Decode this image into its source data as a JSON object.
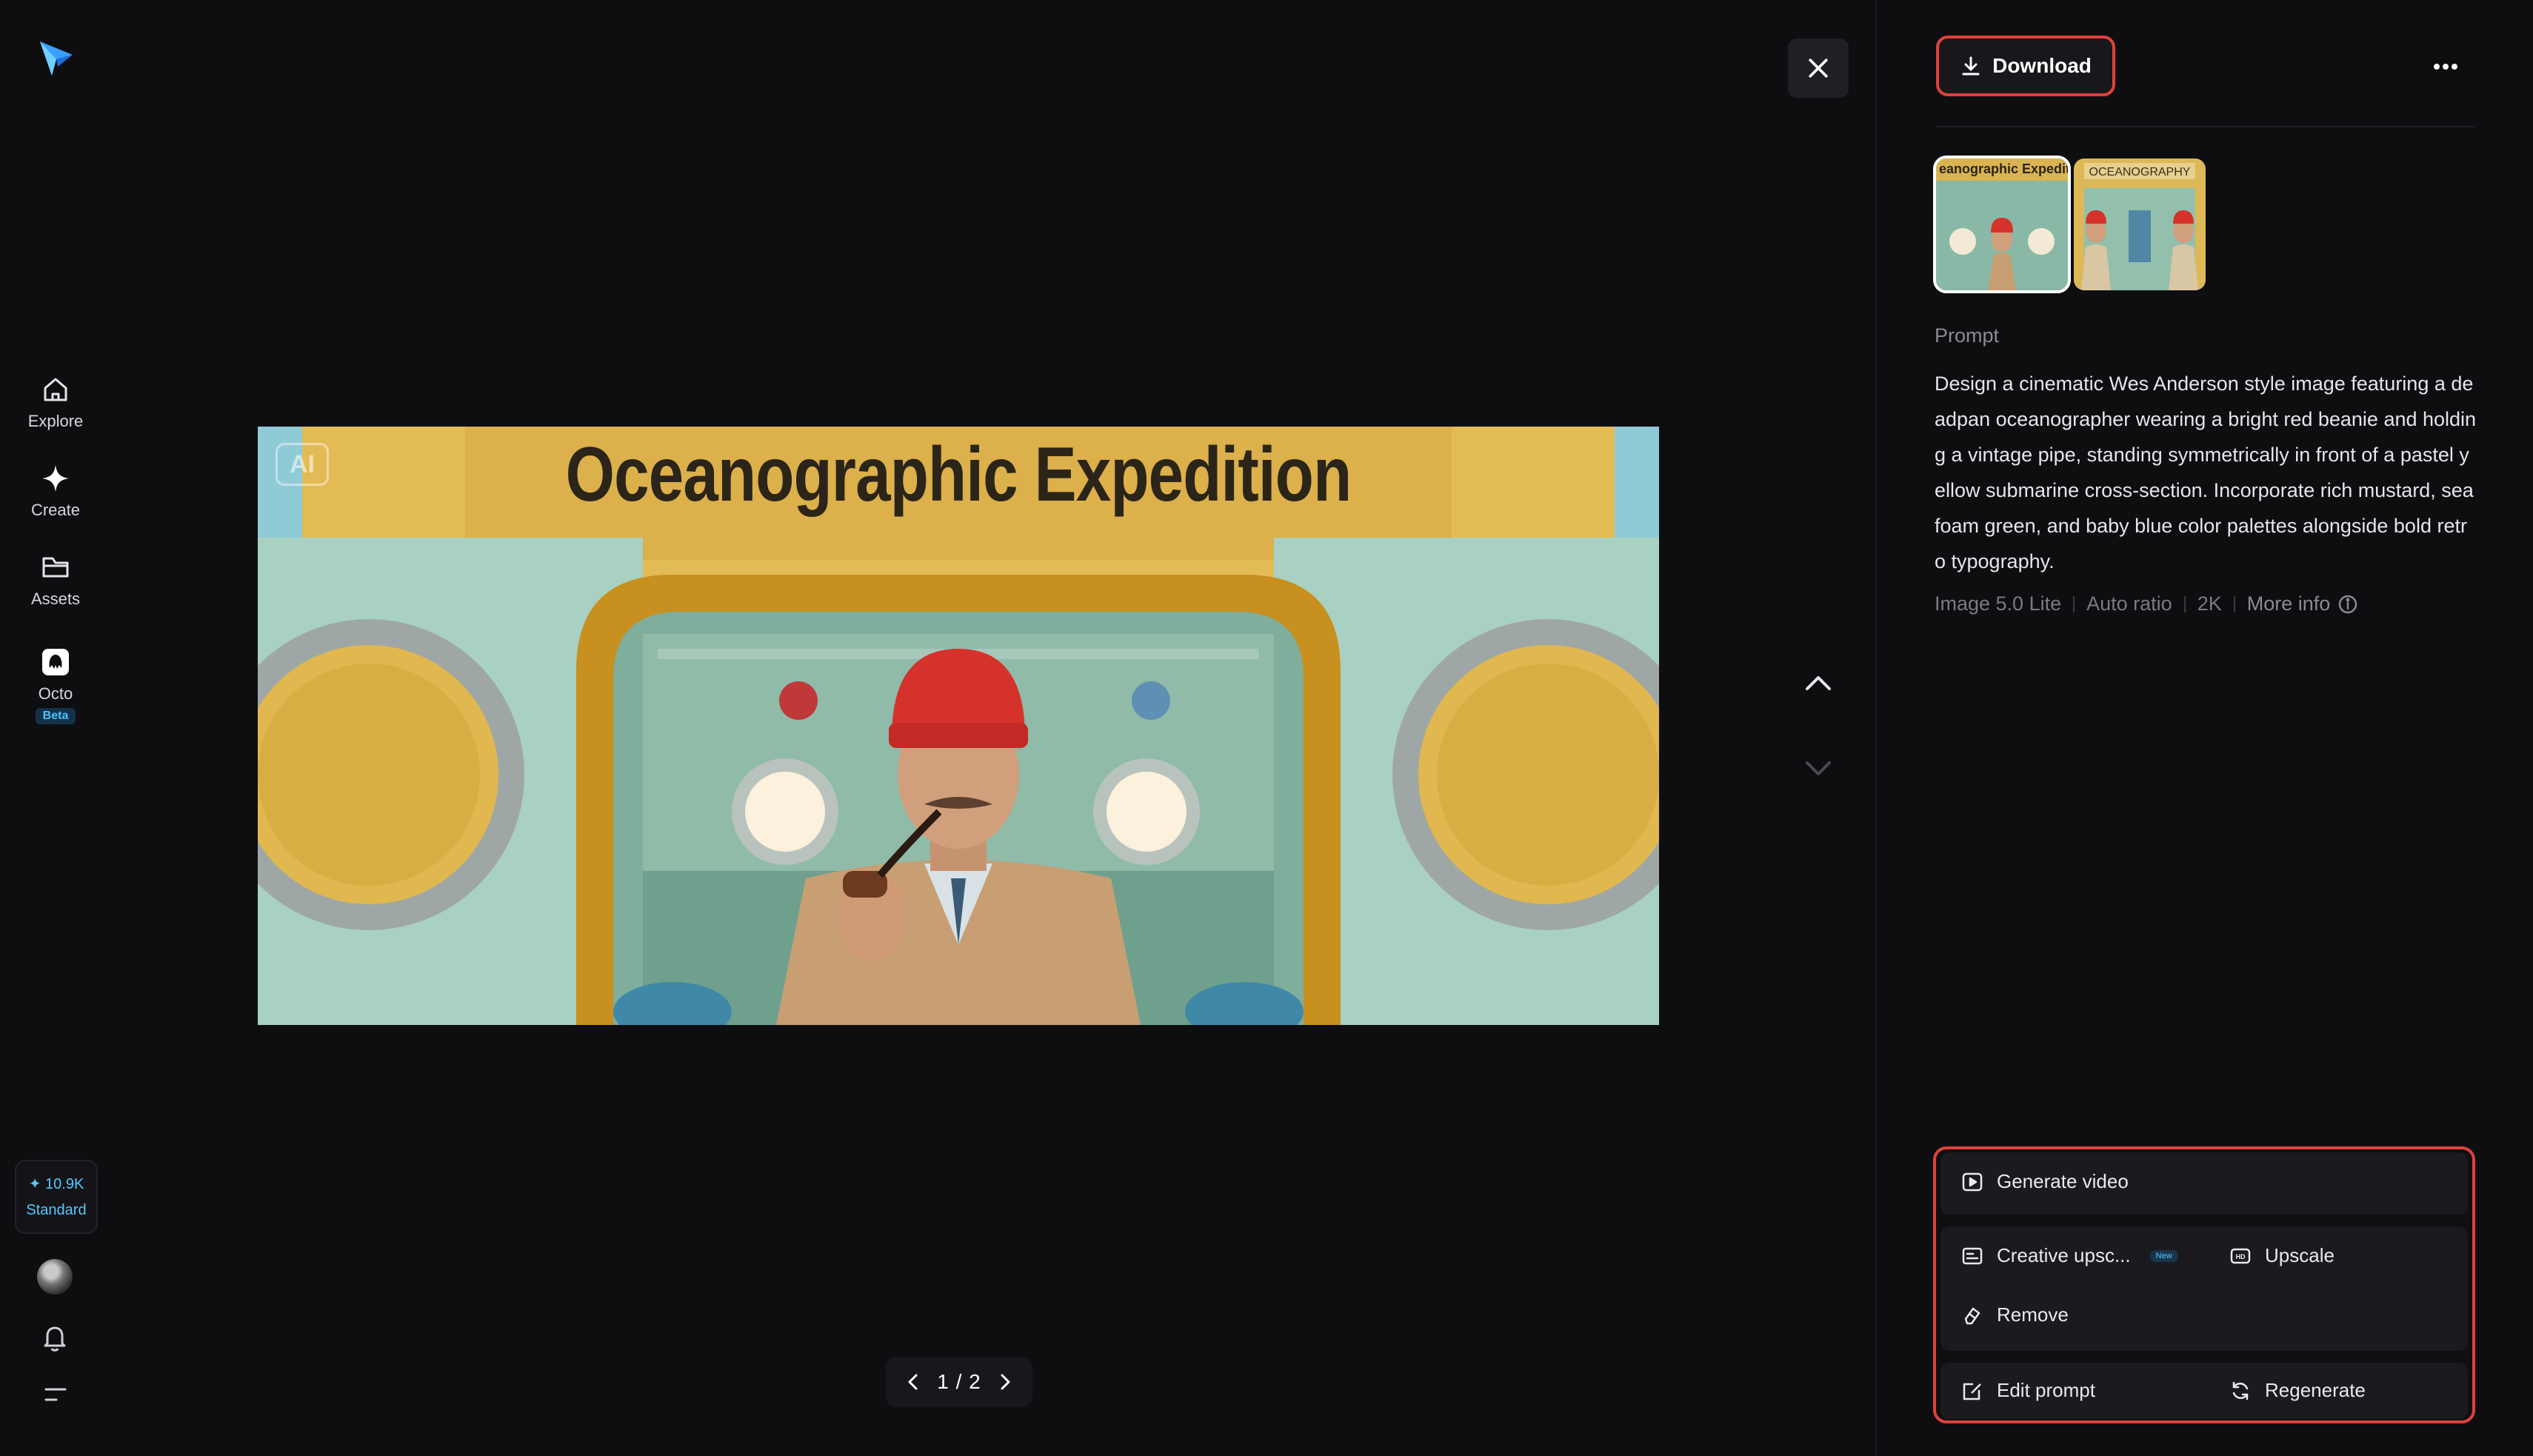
{
  "nav": {
    "items": [
      {
        "label": "Explore",
        "icon": "home-icon"
      },
      {
        "label": "Create",
        "icon": "sparkle-icon"
      },
      {
        "label": "Assets",
        "icon": "folder-icon"
      },
      {
        "label": "Octo",
        "icon": "octo-icon",
        "badge": "Beta"
      }
    ],
    "credits": {
      "amount": "✦ 10.9K",
      "tier": "Standard"
    }
  },
  "viewer": {
    "image_title_text": "Oceanographic Expedition",
    "ai_tag": "AI",
    "pager": "1 / 2"
  },
  "panel": {
    "download_label": "Download",
    "prompt_label": "Prompt",
    "prompt_text": "Design a cinematic Wes Anderson style image featuring a deadpan oceanographer wearing a bright red beanie and holding a vintage pipe, standing symmetrically in front of a pastel yellow submarine cross-section. Incorporate rich mustard, seafoam green, and baby blue color palettes alongside bold retro typography.",
    "meta": [
      "Image 5.0 Lite",
      "Auto ratio",
      "2K"
    ],
    "more_info": "More info",
    "thumbnails": [
      {
        "caption": "eanographic Expedit",
        "selected": true
      },
      {
        "caption": "OCEANOGRAPHY",
        "selected": false
      }
    ]
  },
  "actions": {
    "generate_video": "Generate video",
    "creative_upscale": "Creative upsc...",
    "new_badge": "New",
    "upscale": "Upscale",
    "remove": "Remove",
    "edit_prompt": "Edit prompt",
    "regenerate": "Regenerate"
  },
  "colors": {
    "accent_red": "#e0413a",
    "credit_blue": "#56c8ff",
    "background": "#0e0e11"
  }
}
